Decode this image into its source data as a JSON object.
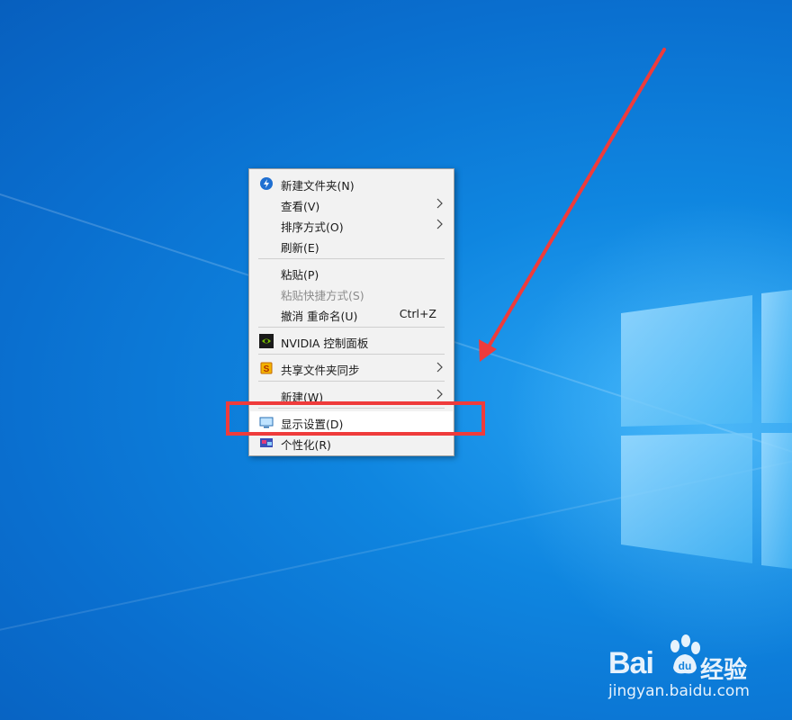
{
  "menu": {
    "items": [
      {
        "label": "新建文件夹(N)",
        "icon": "folder-new-icon",
        "submenu": false
      },
      {
        "label": "查看(V)",
        "submenu": true
      },
      {
        "label": "排序方式(O)",
        "submenu": true
      },
      {
        "label": "刷新(E)",
        "submenu": false
      },
      {
        "label": "粘贴(P)",
        "submenu": false
      },
      {
        "label": "粘贴快捷方式(S)",
        "disabled": true,
        "submenu": false
      },
      {
        "label": "撤消 重命名(U)",
        "shortcut": "Ctrl+Z",
        "submenu": false
      },
      {
        "label": "NVIDIA 控制面板",
        "icon": "nvidia-icon",
        "submenu": false
      },
      {
        "label": "共享文件夹同步",
        "icon": "share-sync-icon",
        "submenu": true
      },
      {
        "label": "新建(W)",
        "submenu": true
      },
      {
        "label": "显示设置(D)",
        "icon": "display-icon",
        "submenu": false,
        "highlighted": true
      },
      {
        "label": "个性化(R)",
        "icon": "personalize-icon",
        "submenu": false
      }
    ]
  },
  "watermark": {
    "brand": "Bai",
    "service": "经验",
    "site": "jingyan.baidu.com"
  },
  "annotation": {
    "color": "#ef3b3b"
  }
}
